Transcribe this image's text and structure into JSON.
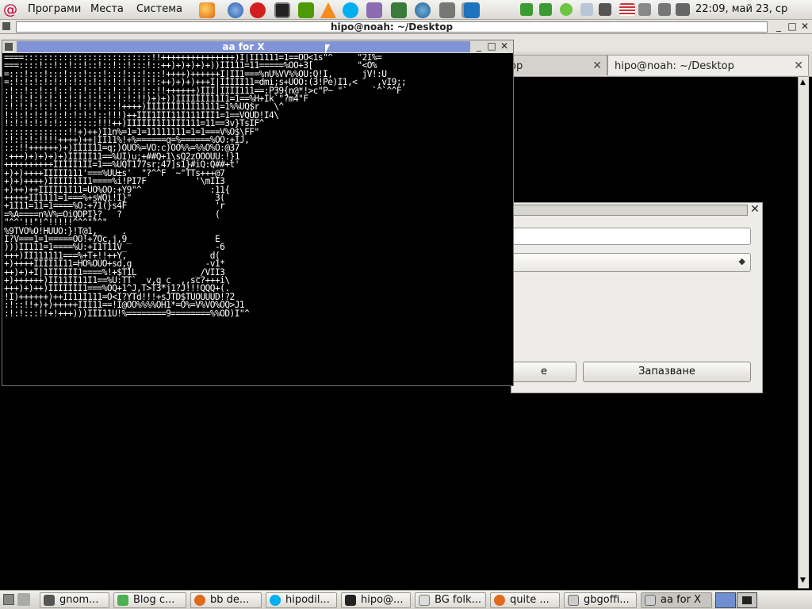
{
  "top_panel": {
    "menus": [
      "Програми",
      "Места",
      "Система"
    ],
    "clock": "22:09, май 23, ср",
    "launchers": [
      "iceweasel-icon",
      "thunderbird-icon",
      "opera-icon",
      "terminal-icon",
      "network-icon",
      "vlc-icon",
      "skype-icon",
      "pidgin-icon",
      "package-icon",
      "globe-icon",
      "archive-icon",
      "notes-icon",
      "teamviewer-icon"
    ],
    "tray": [
      "chat-icon",
      "mail-icon",
      "bluetooth-icon",
      "network-icon",
      "flag-icon",
      "volume-icon",
      "battery-icon"
    ]
  },
  "terminal": {
    "title": "hipo@noah: ~/Desktop",
    "tabs": [
      {
        "label": "op"
      },
      {
        "label": "hipo@noah: ~/Desktop"
      }
    ]
  },
  "dialog": {
    "buttons": [
      "е",
      "Запазване"
    ]
  },
  "aa_window": {
    "title": "aa for X",
    "lines": [
      "====::::::::::::::::::::::::::!!+++++++++++++++)I|II1111=1==OO<1s\"^     \"2I%=",
      "===::::!::!::!::!::!::!::!:::!::++)+)+)+)+))II111=11=====%OO+3[         \"<O%",
      "=:::!:::!:::!:::!:::!:::!:::!:::!++++)++++++I|II1===%nU%VV%%OU:Q!I,      jV!:U",
      "=:!:!:!:!:!:!:!:!:!:!:!:!:!:!:!:++)+)+)+++I|IIIII11=dmi;s+UOO:(3!Pe)I1,<    ,vI9;;",
      ":!::!::!::!::!::!::!::!::!::!::!!++++++)III|IIII111==:P39{n@*!>c\"P~ \"`     `^`^^F",
      ":!:!:!:!:!:!:!:!:!:!:!:!:!:!!)+)+))IIIIIII11I1=1==%H+Ik`\"?m4\"F",
      ":!:!:!:!:!:!:!:!:!:!:::!++++)IIIIIII11I11111=1%%UQ$r   \\^",
      "!:!:!:!:!:!:!:!:!:!::!!!)++III1III11I111III1=1==VQUD!I4\\",
      "!:!:!:!:!:!::::::::!!!++)IIIIII1I1III111=11==3v}TsIF^",
      ":::::::::::::!!+)++)I1n%=1=1=11111111=1=1===V%O$\\FF\"",
      ":!:!:!:!!!!++++)++|II11%!+%======q=%======%OO:+IJ,",
      ":::!!++++++)+)IIII11=q;)OUO%=VO:c)OO%%=%%O%O:@37",
      ":+++)+)+)+)+)IIIII11==%UI)u;+##Q+1\\sQ2zOOOUU:!}1",
      "++++++++++IIIII1II=1==%UQT177sr;47]s1}#iQ:Q##+t'",
      "+)+)++++IIIII111'===%UU±s'  \"?^^F  ~\"TTs+++@7",
      "+)+)++++)IIIII1II1====%i!PI7F          '\\mII3",
      "+)++)++IIIII1I11=UO%OO:+Y9\"^              :11{",
      "+++++II1111=1===%+sWQi!I}\"                 3(",
      "+1I11=11=1====%O:+71(}s4F                  'r",
      "=%A====n%V%=OiQDPI}?   ?                   (",
      "\"^^'!!\"!^!!!!!^^^\"\"^\"",
      "%9TVO%O!HUUO:}!T@1,_    .",
      "I?V===1=1=====OO!+7Oc,j,9_                 E",
      ")))II111=1====%U:+I1T11V_                  -6",
      "+++)II111111===%+T+!!++Y,                 d(",
      "+)++++IIII1I11=HO%OUO+sd,g               -v1*",
      "++)+)+I|1IIIIII1====%!+$T1L            _/VII3",
      "+)++++++)II11II11I1==%U:TT`  v,g_c  ,,sc?+++i\\",
      "+++)+)++)IIIIIII1===%OQ+1^J,T>T3*j1?J!!!QQQ+(.",
      "!I)++++++)++II11I111=O<I?YTd!!!+sJTD$TUOUUUD!?2",
      ":!::!!+)+)+++++III11==!I@OO%%%%OH1*=O%=V%VO%OQ>J1",
      ":!:!:::!!+!+++)))III11U!%========9========%%OD)I\"^"
    ]
  },
  "taskbar": {
    "items": [
      {
        "label": "gnom...",
        "icon": "camera-icon"
      },
      {
        "label": "Blog c...",
        "icon": "leaf-icon"
      },
      {
        "label": "bb de...",
        "icon": "iceweasel-icon"
      },
      {
        "label": "hipodil...",
        "icon": "skype-icon"
      },
      {
        "label": "hipo@...",
        "icon": "terminal-icon"
      },
      {
        "label": "BG folk...",
        "icon": "document-icon"
      },
      {
        "label": "quite ...",
        "icon": "iceweasel-icon"
      },
      {
        "label": "gbgoffi...",
        "icon": "window-icon"
      },
      {
        "label": "aa for X",
        "icon": "window-icon"
      }
    ]
  }
}
